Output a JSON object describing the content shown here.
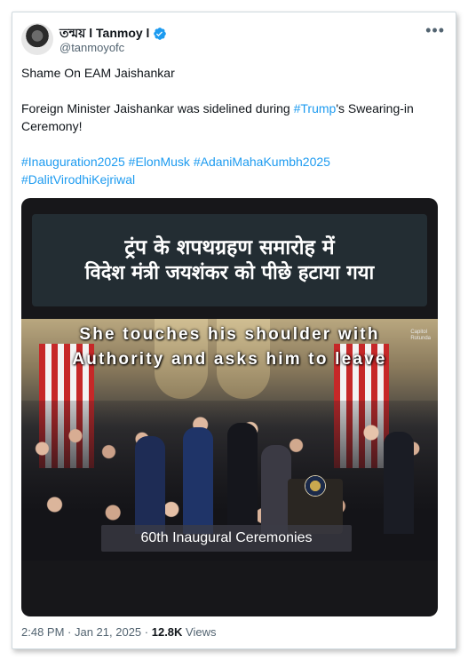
{
  "author": {
    "display_name": "তন্ময় l Tanmoy l",
    "handle": "@tanmoyofc",
    "verified_icon": "verified-badge-icon",
    "more_icon": "more-options-icon"
  },
  "tweet": {
    "line1": "Shame On EAM Jaishankar",
    "line2_before": "Foreign Minister Jaishankar was sidelined during ",
    "line2_link": "#Trump",
    "line2_after": "'s Swearing-in Ceremony!",
    "hashtags_row1": [
      "#Inauguration2025",
      "#ElonMusk",
      "#AdaniMahaKumbh2025"
    ],
    "hashtags_row2": [
      "#DalitVirodhiKejriwal"
    ]
  },
  "media": {
    "banner_line1": "ट्रंप के शपथग्रहण समारोह में",
    "banner_line2": "विदेश मंत्री जयशंकर को पीछे हटाया गया",
    "overlay_line1": "She touches his shoulder with",
    "overlay_line2": "Authority and asks him to leave",
    "watermark_line1": "Capitol",
    "watermark_line2": "Rotunda",
    "lower_third": "60th Inaugural Ceremonies"
  },
  "meta": {
    "time": "2:48 PM",
    "separator": " · ",
    "date": "Jan 21, 2025",
    "views_count": "12.8K",
    "views_label": " Views"
  },
  "colors": {
    "link": "#1d9bf0",
    "verified": "#1d9bf0",
    "text": "#0f1419",
    "muted": "#536471"
  }
}
